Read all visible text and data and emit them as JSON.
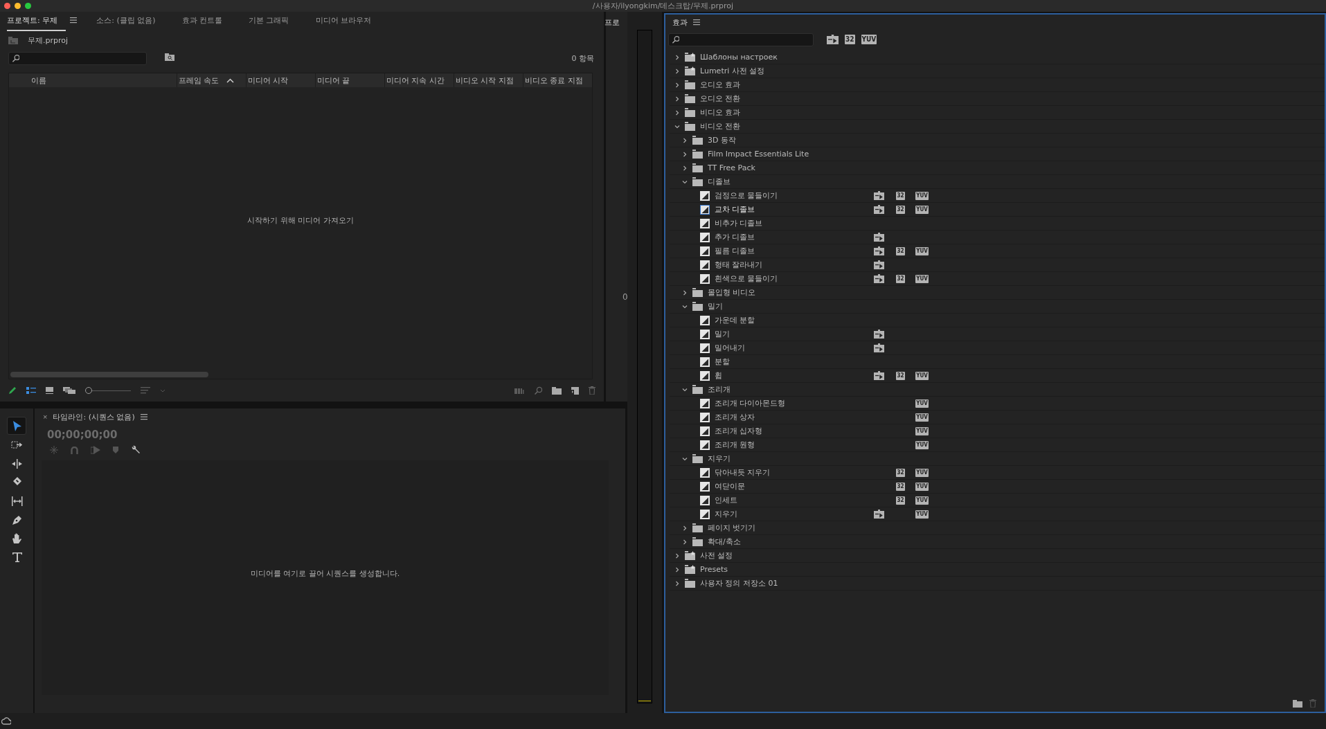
{
  "window": {
    "title": "/사용자/ilyongkim/데스크탑/무제.prproj"
  },
  "project_panel": {
    "tabs": [
      {
        "label": "프로젝트: 무제",
        "selected": true
      },
      {
        "label": "소스: (클립 없음)",
        "selected": false
      },
      {
        "label": "효과 컨트롤",
        "selected": false
      },
      {
        "label": "기본 그래픽",
        "selected": false
      },
      {
        "label": "미디어 브라우저",
        "selected": false
      }
    ],
    "project_file": "무제.prproj",
    "item_count": "0 항목",
    "columns": [
      {
        "label": "이름",
        "sorted": false
      },
      {
        "label": "프레임 속도",
        "sorted": true
      },
      {
        "label": "미디어 시작",
        "sorted": false
      },
      {
        "label": "미디어 끝",
        "sorted": false
      },
      {
        "label": "미디어 지속 시간",
        "sorted": false
      },
      {
        "label": "비디오 시작 지점",
        "sorted": false
      },
      {
        "label": "비디오 종료 지점",
        "sorted": false
      }
    ],
    "empty_message": "시작하기 위해 미디어 가져오기",
    "view": {
      "list_view": true,
      "level": 0
    }
  },
  "side_panel": {
    "tab": "프로",
    "reading": "0"
  },
  "tools": [
    {
      "kind": "selection",
      "selected": true
    },
    {
      "kind": "track_select",
      "selected": false
    },
    {
      "kind": "ripple",
      "selected": false
    },
    {
      "kind": "razor",
      "selected": false
    },
    {
      "kind": "slip",
      "selected": false
    },
    {
      "kind": "pen",
      "selected": false
    },
    {
      "kind": "hand",
      "selected": false
    },
    {
      "kind": "type",
      "selected": false
    }
  ],
  "timeline": {
    "title": "타임라인: (시퀀스 없음)",
    "close": "×",
    "timecode": "00;00;00;00",
    "empty_message": "미디어를 여기로 끌어 시퀀스를 생성합니다."
  },
  "effects": {
    "title": "효과",
    "filters": [
      {
        "kind": "accelerated"
      },
      {
        "kind": "bit32",
        "label": "32"
      },
      {
        "kind": "yuv",
        "label": "YUV"
      }
    ],
    "tree": [
      {
        "kind": "preset_folder",
        "label": "Шаблоны настроек",
        "expanded": false,
        "selected": false
      },
      {
        "kind": "preset_folder",
        "label": "Lumetri 사전 설정",
        "expanded": false,
        "selected": false
      },
      {
        "kind": "folder",
        "label": "오디오 효과",
        "expanded": false,
        "selected": false
      },
      {
        "kind": "folder",
        "label": "오디오 전환",
        "expanded": false,
        "selected": false
      },
      {
        "kind": "folder",
        "label": "비디오 효과",
        "expanded": false,
        "selected": false
      },
      {
        "kind": "folder",
        "label": "비디오 전환",
        "expanded": true,
        "selected": false,
        "children": [
          {
            "kind": "folder",
            "label": "3D 동작",
            "expanded": false,
            "selected": false
          },
          {
            "kind": "folder",
            "label": "Film Impact Essentials Lite",
            "expanded": false,
            "selected": false
          },
          {
            "kind": "folder",
            "label": "TT Free Pack",
            "expanded": false,
            "selected": false
          },
          {
            "kind": "folder",
            "label": "디졸브",
            "expanded": true,
            "selected": false,
            "children": [
              {
                "kind": "effect",
                "label": "검정으로 물들이기",
                "selected": false,
                "badges": [
                  {
                    "kind": "accelerated"
                  },
                  {
                    "kind": "bit32",
                    "label": "32"
                  },
                  {
                    "kind": "yuv",
                    "label": "YUV"
                  }
                ]
              },
              {
                "kind": "effect",
                "label": "교차 디졸브",
                "selected": true,
                "badges": [
                  {
                    "kind": "accelerated"
                  },
                  {
                    "kind": "bit32",
                    "label": "32"
                  },
                  {
                    "kind": "yuv",
                    "label": "YUV"
                  }
                ]
              },
              {
                "kind": "effect",
                "label": "비추가 디졸브",
                "selected": false
              },
              {
                "kind": "effect",
                "label": "추가 디졸브",
                "selected": false,
                "badges": [
                  {
                    "kind": "accelerated"
                  }
                ]
              },
              {
                "kind": "effect",
                "label": "필름 디졸브",
                "selected": false,
                "badges": [
                  {
                    "kind": "accelerated"
                  },
                  {
                    "kind": "bit32",
                    "label": "32"
                  },
                  {
                    "kind": "yuv",
                    "label": "YUV"
                  }
                ]
              },
              {
                "kind": "effect",
                "label": "형태 잘라내기",
                "selected": false,
                "badges": [
                  {
                    "kind": "accelerated"
                  }
                ]
              },
              {
                "kind": "effect",
                "label": "흰색으로 물들이기",
                "selected": false,
                "badges": [
                  {
                    "kind": "accelerated"
                  },
                  {
                    "kind": "bit32",
                    "label": "32"
                  },
                  {
                    "kind": "yuv",
                    "label": "YUV"
                  }
                ]
              }
            ]
          },
          {
            "kind": "folder",
            "label": "몰입형 비디오",
            "expanded": false,
            "selected": false
          },
          {
            "kind": "folder",
            "label": "밀기",
            "expanded": true,
            "selected": false,
            "children": [
              {
                "kind": "effect",
                "label": "가운데 분할",
                "selected": false
              },
              {
                "kind": "effect",
                "label": "밀기",
                "selected": false,
                "badges": [
                  {
                    "kind": "accelerated"
                  }
                ]
              },
              {
                "kind": "effect",
                "label": "밀어내기",
                "selected": false,
                "badges": [
                  {
                    "kind": "accelerated"
                  }
                ]
              },
              {
                "kind": "effect",
                "label": "분할",
                "selected": false
              },
              {
                "kind": "effect",
                "label": "휩",
                "selected": false,
                "badges": [
                  {
                    "kind": "accelerated"
                  },
                  {
                    "kind": "bit32",
                    "label": "32"
                  },
                  {
                    "kind": "yuv",
                    "label": "YUV"
                  }
                ]
              }
            ]
          },
          {
            "kind": "folder",
            "label": "조리개",
            "expanded": true,
            "selected": false,
            "children": [
              {
                "kind": "effect",
                "label": "조리개 다이아몬드형",
                "selected": false,
                "badges": [
                  {
                    "kind": "yuv",
                    "label": "YUV"
                  }
                ]
              },
              {
                "kind": "effect",
                "label": "조리개 상자",
                "selected": false,
                "badges": [
                  {
                    "kind": "yuv",
                    "label": "YUV"
                  }
                ]
              },
              {
                "kind": "effect",
                "label": "조리개 십자형",
                "selected": false,
                "badges": [
                  {
                    "kind": "yuv",
                    "label": "YUV"
                  }
                ]
              },
              {
                "kind": "effect",
                "label": "조리개 원형",
                "selected": false,
                "badges": [
                  {
                    "kind": "yuv",
                    "label": "YUV"
                  }
                ]
              }
            ]
          },
          {
            "kind": "folder",
            "label": "지우기",
            "expanded": true,
            "selected": false,
            "children": [
              {
                "kind": "effect",
                "label": "닦아내듯 지우기",
                "selected": false,
                "badges": [
                  {
                    "kind": "bit32",
                    "label": "32"
                  },
                  {
                    "kind": "yuv",
                    "label": "YUV"
                  }
                ]
              },
              {
                "kind": "effect",
                "label": "여닫이문",
                "selected": false,
                "badges": [
                  {
                    "kind": "bit32",
                    "label": "32"
                  },
                  {
                    "kind": "yuv",
                    "label": "YUV"
                  }
                ]
              },
              {
                "kind": "effect",
                "label": "인세트",
                "selected": false,
                "badges": [
                  {
                    "kind": "bit32",
                    "label": "32"
                  },
                  {
                    "kind": "yuv",
                    "label": "YUV"
                  }
                ]
              },
              {
                "kind": "effect",
                "label": "지우기",
                "selected": false,
                "badges": [
                  {
                    "kind": "accelerated"
                  },
                  {
                    "kind": "yuv",
                    "label": "YUV"
                  }
                ]
              }
            ]
          },
          {
            "kind": "folder",
            "label": "페이지 벗기기",
            "expanded": false,
            "selected": false
          },
          {
            "kind": "folder",
            "label": "확대/축소",
            "expanded": false,
            "selected": false
          }
        ]
      },
      {
        "kind": "preset_folder",
        "label": "사전 설정",
        "expanded": false,
        "selected": false
      },
      {
        "kind": "preset_folder",
        "label": "Presets",
        "expanded": false,
        "selected": false
      },
      {
        "kind": "folder",
        "label": "사용자 정의 저장소 01",
        "expanded": false,
        "selected": false
      }
    ]
  }
}
